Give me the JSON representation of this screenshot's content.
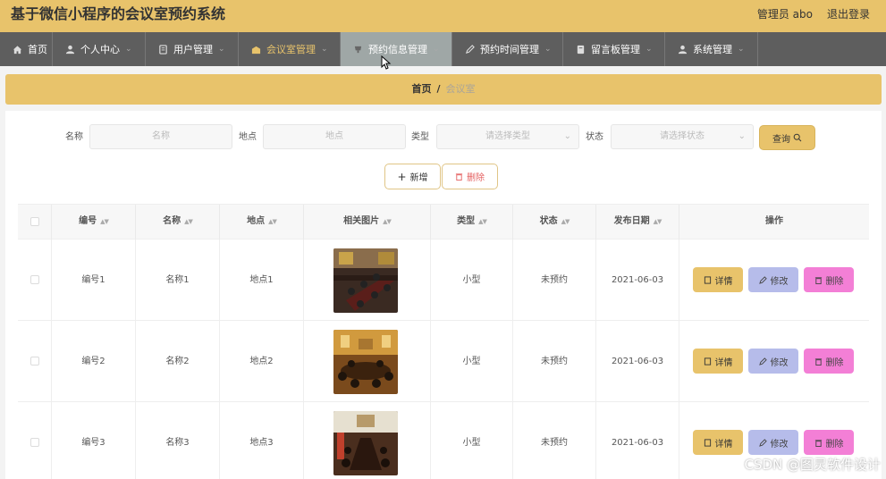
{
  "app": {
    "title": "基于微信小程序的会议室预约系统",
    "admin_label": "管理员 abo",
    "logout_label": "退出登录"
  },
  "nav": [
    {
      "label": "首页",
      "icon": "home-icon"
    },
    {
      "label": "个人中心",
      "icon": "user-icon"
    },
    {
      "label": "用户管理",
      "icon": "list-icon"
    },
    {
      "label": "会议室管理",
      "icon": "building-icon"
    },
    {
      "label": "预约信息管理",
      "icon": "cup-icon"
    },
    {
      "label": "预约时间管理",
      "icon": "pen-icon"
    },
    {
      "label": "留言板管理",
      "icon": "book-icon"
    },
    {
      "label": "系统管理",
      "icon": "user-icon"
    }
  ],
  "breadcrumb": {
    "home": "首页",
    "separator": "/",
    "current": "会议室"
  },
  "filters": {
    "name_label": "名称",
    "name_placeholder": "名称",
    "place_label": "地点",
    "place_placeholder": "地点",
    "type_label": "类型",
    "type_placeholder": "请选择类型",
    "status_label": "状态",
    "status_placeholder": "请选择状态",
    "query_button": "查询"
  },
  "actions": {
    "add_button": "新增",
    "delete_button": "删除"
  },
  "table": {
    "headers": [
      "编号",
      "名称",
      "地点",
      "相关图片",
      "类型",
      "状态",
      "发布日期",
      "操作"
    ],
    "rows": [
      {
        "id": "编号1",
        "name": "名称1",
        "place": "地点1",
        "type": "小型",
        "status": "未预约",
        "date": "2021-06-03"
      },
      {
        "id": "编号2",
        "name": "名称2",
        "place": "地点2",
        "type": "小型",
        "status": "未预约",
        "date": "2021-06-03"
      },
      {
        "id": "编号3",
        "name": "名称3",
        "place": "地点3",
        "type": "小型",
        "status": "未预约",
        "date": "2021-06-03"
      }
    ],
    "row_actions": {
      "detail": "详情",
      "edit": "修改",
      "delete": "删除"
    }
  },
  "watermark": "CSDN @图灵软件设计",
  "colors": {
    "accent": "#e8c36b",
    "nav_bg": "#5e5e5e",
    "edit": "#b6bcea",
    "delete": "#f37fd6"
  }
}
